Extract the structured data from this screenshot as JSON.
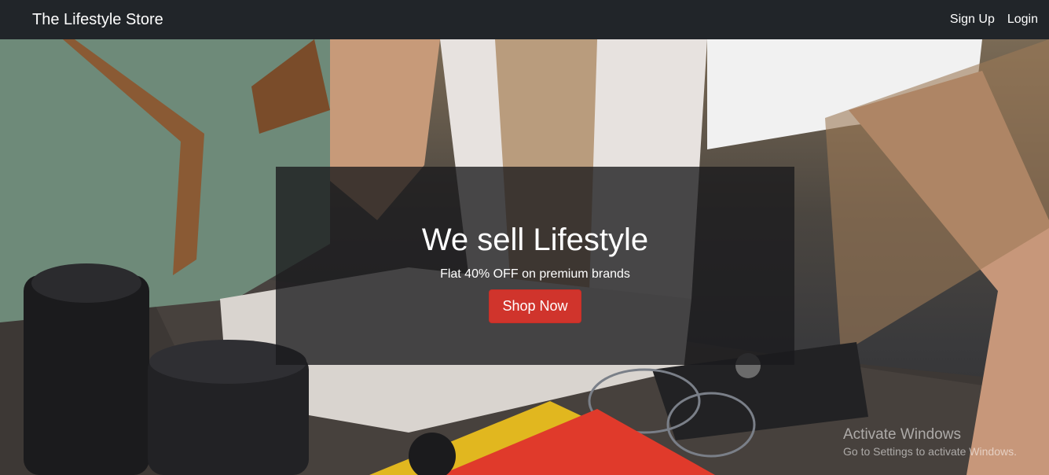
{
  "navbar": {
    "brand": "The Lifestyle Store",
    "links": [
      "Sign Up",
      "Login"
    ]
  },
  "hero": {
    "title": "We sell Lifestyle",
    "subtitle": "Flat 40% OFF on premium brands",
    "button_label": "Shop Now"
  },
  "watermark": {
    "title": "Activate Windows",
    "subtitle": "Go to Settings to activate Windows."
  },
  "colors": {
    "navbar_bg": "#212529",
    "button_bg": "#d0342c",
    "caption_bg": "rgba(25,25,28,0.78)"
  }
}
